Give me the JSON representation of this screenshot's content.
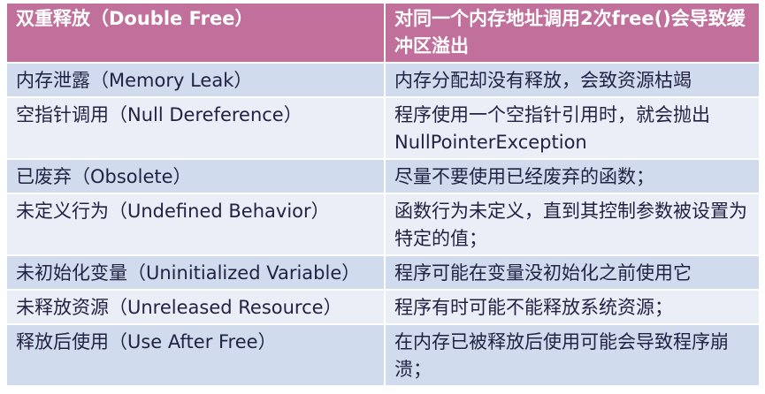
{
  "header": {
    "term": "双重释放（Double Free）",
    "description": "对同一个内存地址调用2次free()会导致缓冲区溢出"
  },
  "rows": [
    {
      "term": "内存泄露（Memory Leak）",
      "description": "内存分配却没有释放，会致资源枯竭"
    },
    {
      "term": "空指针调用（Null Dereference）",
      "description": "程序使用一个空指针引用时，就会抛出NullPointerException"
    },
    {
      "term": "已废弃（Obsolete）",
      "description": "尽量不要使用已经废弃的函数；"
    },
    {
      "term": "未定义行为（Undefined Behavior）",
      "description": "函数行为未定义，直到其控制参数被设置为特定的值；"
    },
    {
      "term": "未初始化变量（Uninitialized Variable）",
      "description": "程序可能在变量没初始化之前使用它"
    },
    {
      "term": "未释放资源（Unreleased Resource）",
      "description": "程序有时可能不能释放系统资源；"
    },
    {
      "term": "释放后使用（Use After Free）",
      "description": "在内存已被释放后使用可能会导致程序崩溃；"
    }
  ],
  "colors": {
    "header_bg": "#c0709a",
    "row_dark": "#d0dcee",
    "row_light": "#e9eef7"
  }
}
